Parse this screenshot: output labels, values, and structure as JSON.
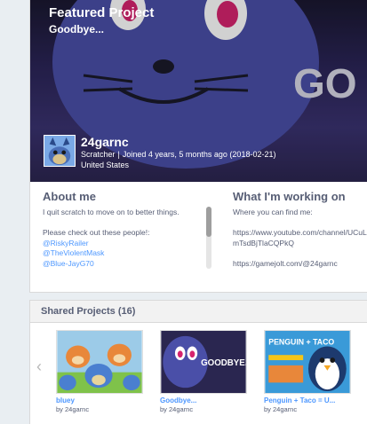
{
  "featured": {
    "heading": "Featured Project",
    "project_title": "Goodbye..."
  },
  "user": {
    "username": "24garnc",
    "role": "Scratcher",
    "joined": "Joined 4 years, 5 months ago (2018-02-21)",
    "location": "United States"
  },
  "about_me": {
    "title": "About me",
    "line1": "I quit scratch to move on to better things.",
    "line2": "Please check out these people!:",
    "links": [
      "@RiskyRailer",
      "@TheViolentMask",
      "@Blue-JayG70"
    ]
  },
  "working_on": {
    "title": "What I'm working on",
    "line1": "Where you can find me:",
    "url1a": "https://www.youtube.com/channel/UCuL",
    "url1b": "mTsdBjTlaCQPkQ",
    "url2": "https://gamejolt.com/@24garnc"
  },
  "shared": {
    "title": "Shared Projects (16)",
    "prev_arrow": "‹",
    "projects": [
      {
        "title": "bluey",
        "by": "by 24garnc",
        "thumb_text": ""
      },
      {
        "title": "Goodbye...",
        "by": "by 24garnc",
        "thumb_text": "GOODBYE..."
      },
      {
        "title": "Penguin + Taco = U...",
        "by": "by 24garnc",
        "thumb_text": "PENGUIN + TACO"
      }
    ]
  },
  "colors": {
    "link": "#4d97ff",
    "text": "#575e75",
    "banner": "#2a2456"
  }
}
